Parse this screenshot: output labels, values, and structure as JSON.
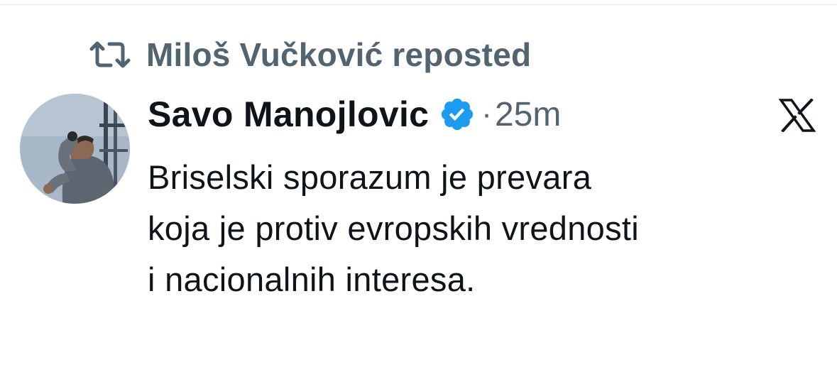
{
  "repost": {
    "icon": "repost-icon",
    "text": "Miloš Vučković reposted"
  },
  "author": {
    "name": "Savo Manojlovic",
    "verified": true,
    "verified_icon": "verified-badge-icon",
    "verified_color": "#1d9bf0",
    "separator": "·",
    "time": "25m"
  },
  "platform": {
    "icon": "x-logo-icon"
  },
  "tweet": {
    "lines": [
      "Briselski sporazum je prevara",
      "koja je protiv evropskih vrednosti",
      "i nacionalnih interesa."
    ]
  },
  "colors": {
    "text_primary": "#0f1419",
    "text_secondary": "#536471",
    "background": "#ffffff"
  }
}
